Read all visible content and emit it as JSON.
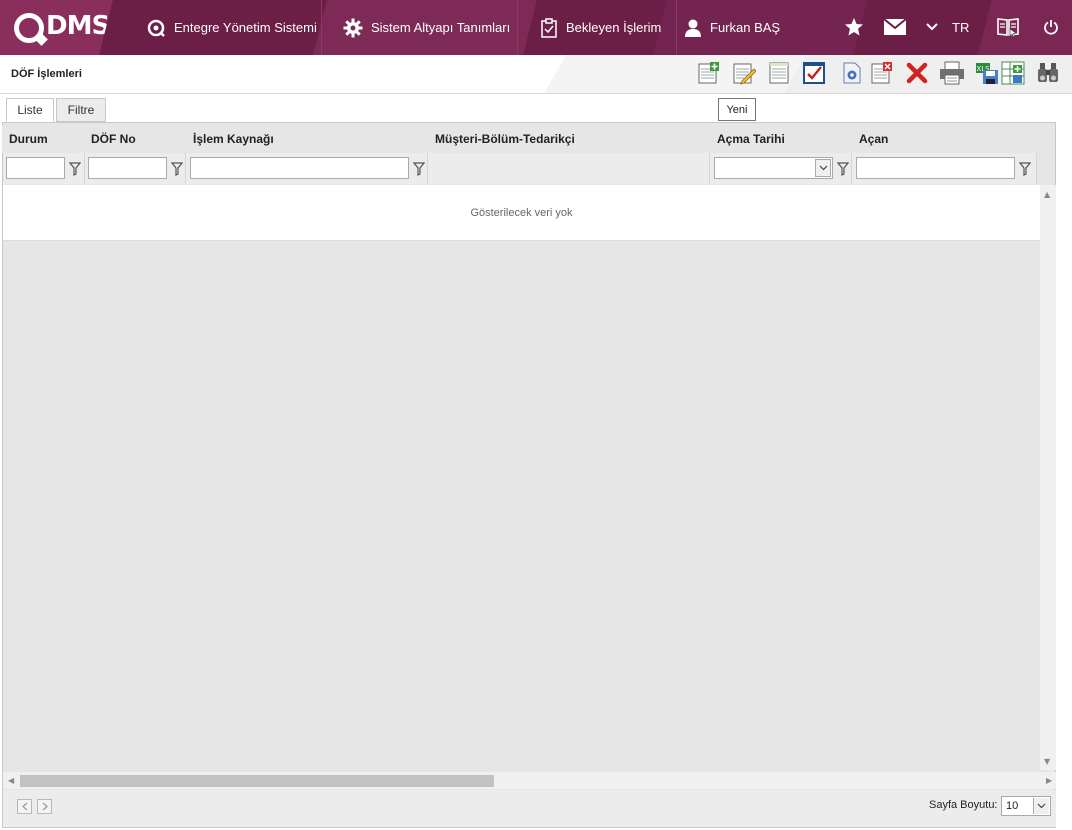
{
  "brand": {
    "logo_text": "DMS"
  },
  "nav": {
    "items": [
      {
        "label": "Entegre Yönetim Sistemi",
        "icon": "q-logo-icon"
      },
      {
        "label": "Sistem Altyapı Tanımları",
        "icon": "gear-icon"
      },
      {
        "label": "Bekleyen İşlerim",
        "icon": "clipboard-icon"
      },
      {
        "label": "Furkan BAŞ",
        "icon": "user-icon"
      }
    ],
    "language": "TR"
  },
  "page": {
    "title": "DÖF İşlemleri"
  },
  "toolbar": {
    "tooltip": "Yeni",
    "buttons": [
      "new",
      "edit",
      "list",
      "approve",
      "process",
      "delete-record",
      "delete",
      "print",
      "export-excel",
      "add-column",
      "binoculars"
    ]
  },
  "tabs": [
    {
      "label": "Liste",
      "active": true
    },
    {
      "label": "Filtre",
      "active": false
    }
  ],
  "grid": {
    "columns": [
      "Durum",
      "DÖF No",
      "İşlem Kaynağı",
      "Müşteri-Bölüm-Tedarikçi",
      "Açma Tarihi",
      "Açan"
    ],
    "empty_message": "Gösterilecek veri yok"
  },
  "pager": {
    "page_size_label": "Sayfa Boyutu:",
    "page_size": "10"
  },
  "colors": {
    "topbar": "#6b1f47",
    "accent": "#8a2f5c",
    "grid_header": "#e6e6e6"
  }
}
